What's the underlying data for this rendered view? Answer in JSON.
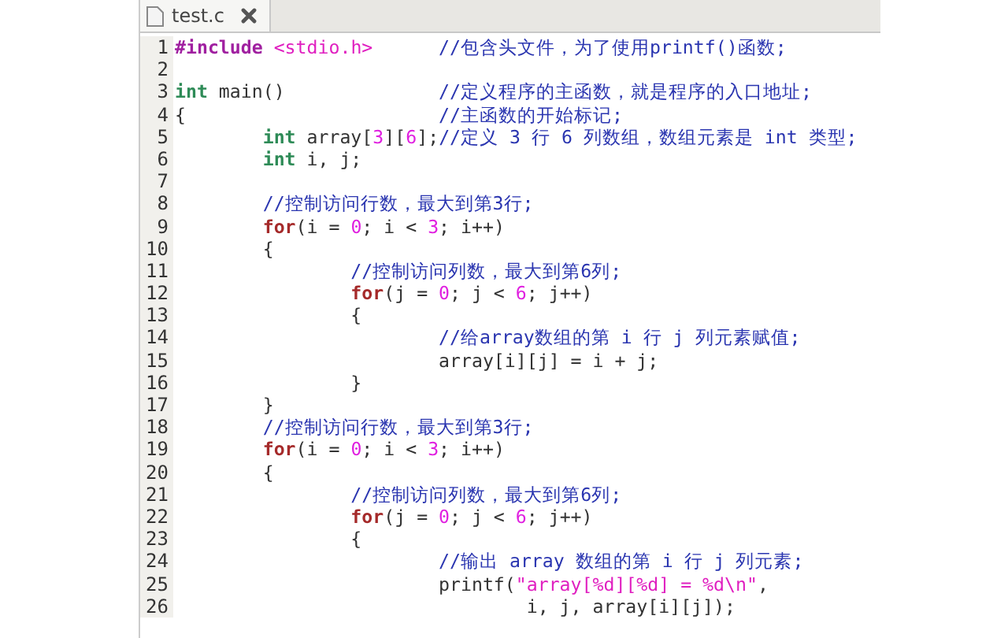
{
  "tab": {
    "title": "test.c",
    "selected": true
  },
  "lines": [
    {
      "number": "1",
      "tokens": [
        {
          "kind": "preproc",
          "text": "#include "
        },
        {
          "kind": "string",
          "text": "<stdio.h>      "
        },
        {
          "kind": "comment",
          "text": "//包含头文件，为了使用printf()函数;"
        }
      ]
    },
    {
      "number": "2"
    },
    {
      "number": "3",
      "tokens": [
        {
          "kind": "type",
          "text": "int"
        },
        {
          "kind": "plain",
          "text": " main()              "
        },
        {
          "kind": "comment",
          "text": "//定义程序的主函数，就是程序的入口地址;"
        }
      ]
    },
    {
      "number": "4",
      "tokens": [
        {
          "kind": "plain",
          "text": "{                       "
        },
        {
          "kind": "comment",
          "text": "//主函数的开始标记;"
        }
      ]
    },
    {
      "number": "5",
      "tokens": [
        {
          "kind": "type",
          "text": "        int"
        },
        {
          "kind": "plain",
          "text": " array["
        },
        {
          "kind": "number",
          "text": "3"
        },
        {
          "kind": "plain",
          "text": "]["
        },
        {
          "kind": "number",
          "text": "6"
        },
        {
          "kind": "plain",
          "text": "];"
        },
        {
          "kind": "comment",
          "text": "//定义 3 行 6 列数组，数组元素是 int 类型;"
        }
      ]
    },
    {
      "number": "6",
      "tokens": [
        {
          "kind": "type",
          "text": "        int"
        },
        {
          "kind": "plain",
          "text": " i, j;"
        }
      ]
    },
    {
      "number": "7"
    },
    {
      "number": "8",
      "tokens": [
        {
          "kind": "comment",
          "text": "        //控制访问行数，最大到第3行;"
        }
      ]
    },
    {
      "number": "9",
      "tokens": [
        {
          "kind": "keyword",
          "text": "        for"
        },
        {
          "kind": "plain",
          "text": "(i = "
        },
        {
          "kind": "number",
          "text": "0"
        },
        {
          "kind": "plain",
          "text": "; i < "
        },
        {
          "kind": "number",
          "text": "3"
        },
        {
          "kind": "plain",
          "text": "; i++)"
        }
      ]
    },
    {
      "number": "10",
      "tokens": [
        {
          "kind": "plain",
          "text": "        {"
        }
      ]
    },
    {
      "number": "11",
      "tokens": [
        {
          "kind": "comment",
          "text": "                //控制访问列数，最大到第6列;"
        }
      ]
    },
    {
      "number": "12",
      "tokens": [
        {
          "kind": "keyword",
          "text": "                for"
        },
        {
          "kind": "plain",
          "text": "(j = "
        },
        {
          "kind": "number",
          "text": "0"
        },
        {
          "kind": "plain",
          "text": "; j < "
        },
        {
          "kind": "number",
          "text": "6"
        },
        {
          "kind": "plain",
          "text": "; j++)"
        }
      ]
    },
    {
      "number": "13",
      "tokens": [
        {
          "kind": "plain",
          "text": "                {"
        }
      ]
    },
    {
      "number": "14",
      "tokens": [
        {
          "kind": "comment",
          "text": "                        //给array数组的第 i 行 j 列元素赋值;"
        }
      ]
    },
    {
      "number": "15",
      "tokens": [
        {
          "kind": "plain",
          "text": "                        array[i][j] = i + j;"
        }
      ]
    },
    {
      "number": "16",
      "tokens": [
        {
          "kind": "plain",
          "text": "                }"
        }
      ]
    },
    {
      "number": "17",
      "tokens": [
        {
          "kind": "plain",
          "text": "        }"
        }
      ]
    },
    {
      "number": "18",
      "tokens": [
        {
          "kind": "comment",
          "text": "        //控制访问行数，最大到第3行;"
        }
      ]
    },
    {
      "number": "19",
      "tokens": [
        {
          "kind": "keyword",
          "text": "        for"
        },
        {
          "kind": "plain",
          "text": "(i = "
        },
        {
          "kind": "number",
          "text": "0"
        },
        {
          "kind": "plain",
          "text": "; i < "
        },
        {
          "kind": "number",
          "text": "3"
        },
        {
          "kind": "plain",
          "text": "; i++)"
        }
      ]
    },
    {
      "number": "20",
      "tokens": [
        {
          "kind": "plain",
          "text": "        {"
        }
      ]
    },
    {
      "number": "21",
      "tokens": [
        {
          "kind": "comment",
          "text": "                //控制访问列数，最大到第6列;"
        }
      ]
    },
    {
      "number": "22",
      "tokens": [
        {
          "kind": "keyword",
          "text": "                for"
        },
        {
          "kind": "plain",
          "text": "(j = "
        },
        {
          "kind": "number",
          "text": "0"
        },
        {
          "kind": "plain",
          "text": "; j < "
        },
        {
          "kind": "number",
          "text": "6"
        },
        {
          "kind": "plain",
          "text": "; j++)"
        }
      ]
    },
    {
      "number": "23",
      "tokens": [
        {
          "kind": "plain",
          "text": "                {"
        }
      ]
    },
    {
      "number": "24",
      "tokens": [
        {
          "kind": "comment",
          "text": "                        //输出 array 数组的第 i 行 j 列元素;"
        }
      ]
    },
    {
      "number": "25",
      "tokens": [
        {
          "kind": "plain",
          "text": "                        printf("
        },
        {
          "kind": "string",
          "text": "\"array[%d][%d] = %d\\n\""
        },
        {
          "kind": "plain",
          "text": ","
        }
      ]
    },
    {
      "number": "26",
      "tokens": [
        {
          "kind": "plain",
          "text": "                                i, j, array[i][j]);"
        }
      ]
    }
  ]
}
